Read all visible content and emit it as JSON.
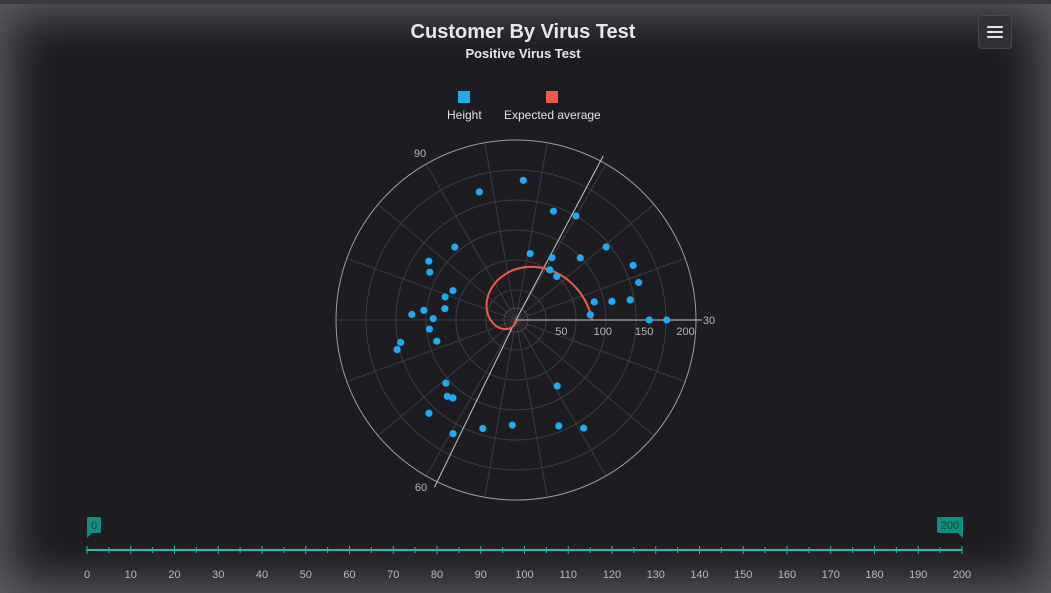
{
  "header": {
    "title": "Customer By Virus Test",
    "subtitle": "Positive Virus Test",
    "menu_icon": "hamburger-menu-icon"
  },
  "legend": [
    {
      "label": "Height",
      "color": "#22aaf0"
    },
    {
      "label": "Expected average",
      "color": "#f05a4a"
    }
  ],
  "chart_data": {
    "type": "scatter",
    "coordinate_system": "polar",
    "title": "Customer By Virus Test",
    "subtitle": "Positive Virus Test",
    "radial_axis": {
      "ticks": [
        50,
        100,
        150,
        200
      ],
      "max": 200
    },
    "angular_axis": {
      "labels": [
        "30",
        "60",
        "90"
      ],
      "direction": "counter-clockwise",
      "start_at_right": true
    },
    "grid": true,
    "legend_position": "top-center",
    "series": [
      {
        "name": "Height",
        "type": "scatter",
        "color": "#22aaf0",
        "points": [
          {
            "r": 182,
            "angle": 0
          },
          {
            "r": 161,
            "angle": 0
          },
          {
            "r": 90,
            "angle": 4
          },
          {
            "r": 97,
            "angle": 13
          },
          {
            "r": 118,
            "angle": 11
          },
          {
            "r": 140,
            "angle": 10
          },
          {
            "r": 155,
            "angle": 17
          },
          {
            "r": 156,
            "angle": 25
          },
          {
            "r": 140,
            "angle": 39
          },
          {
            "r": 108,
            "angle": 44
          },
          {
            "r": 72,
            "angle": 47
          },
          {
            "r": 73,
            "angle": 56
          },
          {
            "r": 87,
            "angle": 60
          },
          {
            "r": 82,
            "angle": 78
          },
          {
            "r": 139,
            "angle": 71
          },
          {
            "r": 145,
            "angle": 60
          },
          {
            "r": 169,
            "angle": 87
          },
          {
            "r": 161,
            "angle": 106
          },
          {
            "r": 115,
            "angle": 130
          },
          {
            "r": 84,
            "angle": 155
          },
          {
            "r": 119,
            "angle": 151
          },
          {
            "r": 90,
            "angle": 162
          },
          {
            "r": 127,
            "angle": 146
          },
          {
            "r": 126,
            "angle": 177
          },
          {
            "r": 112,
            "angle": 174
          },
          {
            "r": 100,
            "angle": 179
          },
          {
            "r": 87,
            "angle": 171
          },
          {
            "r": 105,
            "angle": 186
          },
          {
            "r": 99,
            "angle": 195
          },
          {
            "r": 142,
            "angle": 191
          },
          {
            "r": 148,
            "angle": 194
          },
          {
            "r": 114,
            "angle": 222
          },
          {
            "r": 124,
            "angle": 228
          },
          {
            "r": 121,
            "angle": 231
          },
          {
            "r": 154,
            "angle": 227
          },
          {
            "r": 157,
            "angle": 241
          },
          {
            "r": 137,
            "angle": 253
          },
          {
            "r": 127,
            "angle": 268
          },
          {
            "r": 138,
            "angle": 292
          },
          {
            "r": 94,
            "angle": 302
          },
          {
            "r": 154,
            "angle": 302
          }
        ]
      },
      {
        "name": "Expected average",
        "type": "line",
        "color": "#f05a4a",
        "spiral": {
          "r_start": 0,
          "r_end": 92,
          "angle_start": 270,
          "angle_end": 0,
          "turns_clockwise": true
        }
      }
    ]
  },
  "range_slider": {
    "min_label": "0",
    "max_label": "200",
    "min": 0,
    "max": 200,
    "ticks": [
      "0",
      "10",
      "20",
      "30",
      "40",
      "50",
      "60",
      "70",
      "80",
      "90",
      "100",
      "110",
      "120",
      "130",
      "140",
      "150",
      "160",
      "170",
      "180",
      "190",
      "200"
    ]
  }
}
